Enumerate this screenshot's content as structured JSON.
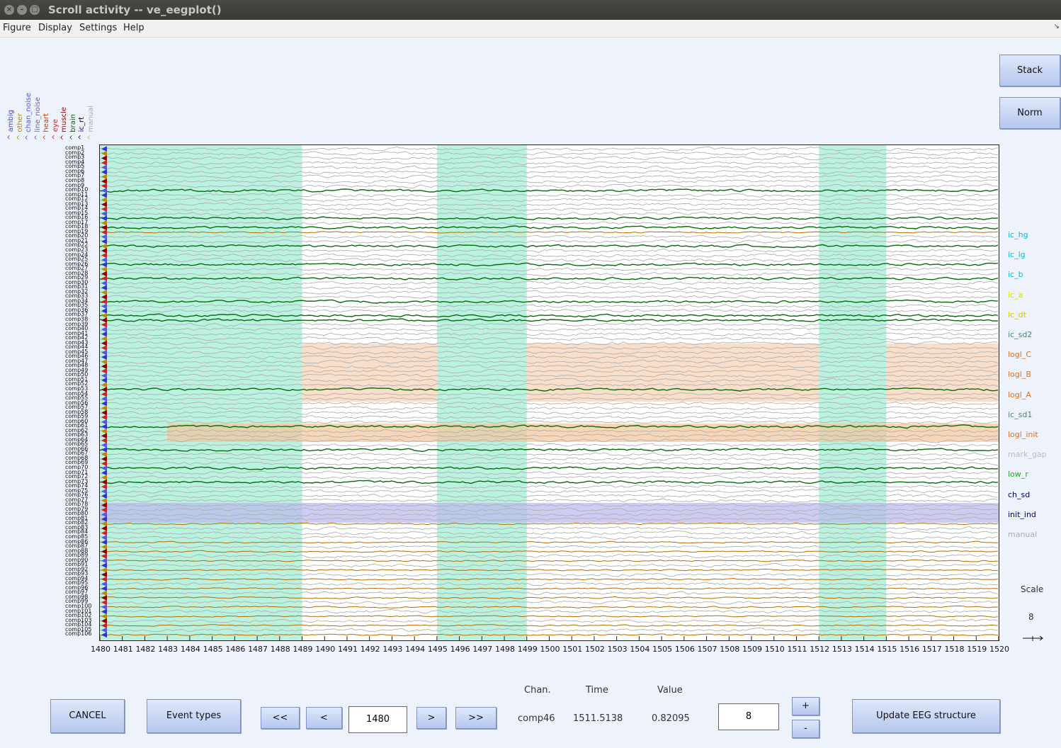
{
  "window": {
    "title": "Scroll activity -- ve_eegplot()"
  },
  "menu": [
    "Figure",
    "Display",
    "Settings",
    "Help"
  ],
  "side_buttons": {
    "stack": "Stack",
    "norm": "Norm"
  },
  "legend": [
    {
      "label": "ambig",
      "color": "#4444cc"
    },
    {
      "label": "other",
      "color": "#b8860b"
    },
    {
      "label": "chan_noise",
      "color": "#5555dd"
    },
    {
      "label": "line_noise",
      "color": "#6666aa"
    },
    {
      "label": "heart",
      "color": "#c04000"
    },
    {
      "label": "eye",
      "color": "#cc2222"
    },
    {
      "label": "muscle",
      "color": "#8b0000"
    },
    {
      "label": "brain",
      "color": "#006400"
    },
    {
      "label": "ic_rt",
      "color": "#000080"
    },
    {
      "label": "manual",
      "color": "#aaaaaa"
    }
  ],
  "tags": [
    {
      "label": "ic_hg",
      "color": "#00bcd4"
    },
    {
      "label": "ic_lg",
      "color": "#00bcd4"
    },
    {
      "label": "ic_b",
      "color": "#00bcd4"
    },
    {
      "label": "ic_a",
      "color": "#dddd00"
    },
    {
      "label": "ic_dt",
      "color": "#cccc00"
    },
    {
      "label": "ic_sd2",
      "color": "#508080"
    },
    {
      "label": "logl_C",
      "color": "#e07020"
    },
    {
      "label": "logl_B",
      "color": "#e07020"
    },
    {
      "label": "logl_A",
      "color": "#e07020"
    },
    {
      "label": "ic_sd1",
      "color": "#508080"
    },
    {
      "label": "logl_init",
      "color": "#e07020"
    },
    {
      "label": "mark_gap",
      "color": "#bbbbbb"
    },
    {
      "label": "low_r",
      "color": "#22aa22"
    },
    {
      "label": "ch_sd",
      "color": "#000066"
    },
    {
      "label": "init_ind",
      "color": "#000066"
    },
    {
      "label": "manual",
      "color": "#aaaaaa"
    }
  ],
  "chart_data": {
    "type": "line",
    "x_range": [
      1480,
      1520
    ],
    "x_ticks": [
      "1480",
      "1481",
      "1482",
      "1483",
      "1484",
      "1485",
      "1486",
      "1487",
      "1488",
      "1489",
      "1490",
      "1491",
      "1492",
      "1493",
      "1494",
      "1495",
      "1496",
      "1497",
      "1498",
      "1499",
      "1500",
      "1501",
      "1502",
      "1503",
      "1504",
      "1505",
      "1506",
      "1507",
      "1508",
      "1509",
      "1510",
      "1511",
      "1512",
      "1513",
      "1514",
      "1515",
      "1516",
      "1517",
      "1518",
      "1519",
      "1520"
    ],
    "channel_count": 106,
    "channel_prefix": "comp",
    "green_channels": [
      10,
      16,
      18,
      22,
      26,
      29,
      34,
      37,
      38,
      53,
      61,
      66,
      70,
      73
    ],
    "orange_channels": [
      19,
      61,
      82,
      86,
      88,
      90,
      92,
      94,
      96,
      98,
      100,
      102,
      104,
      106
    ],
    "time_spans": [
      {
        "x0": 1480,
        "x1": 1489,
        "color": "#aef0da",
        "band": "all"
      },
      {
        "x0": 1495,
        "x1": 1499,
        "color": "#aef0da",
        "band": "all"
      },
      {
        "x0": 1512,
        "x1": 1515,
        "color": "#aef0da",
        "band": "all"
      },
      {
        "x0": 1489,
        "x1": 1495,
        "color": "#f7d1b3",
        "band": "logl"
      },
      {
        "x0": 1499,
        "x1": 1512,
        "color": "#f7d1b3",
        "band": "logl"
      },
      {
        "x0": 1515,
        "x1": 1520,
        "color": "#f7d1b3",
        "band": "logl"
      },
      {
        "x0": 1483,
        "x1": 1520,
        "color": "#f3c49a",
        "band": "logl_init"
      },
      {
        "x0": 1480,
        "x1": 1520,
        "color": "#b8b8ee",
        "band": "init_ind"
      }
    ]
  },
  "scale": {
    "label": "Scale",
    "value": "8"
  },
  "readout": {
    "chan_label": "Chan.",
    "time_label": "Time",
    "value_label": "Value",
    "chan": "comp46",
    "time": "1511.5138",
    "value": "0.82095"
  },
  "controls": {
    "cancel": "CANCEL",
    "event_types": "Event types",
    "first": "<<",
    "prev": "<",
    "next": ">",
    "last": ">>",
    "position": "1480",
    "spacing": "8",
    "plus": "+",
    "minus": "-",
    "update": "Update EEG structure"
  }
}
